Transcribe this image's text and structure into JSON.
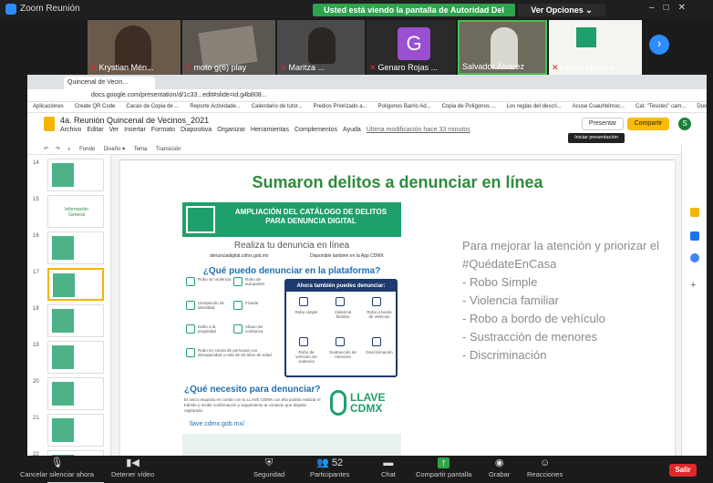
{
  "zoom": {
    "window_title": "Zoom Reunión",
    "share_banner": "Usted está viendo la pantalla de Autoridad Del Centro Histórico",
    "view_options": "Ver Opciones ⌄",
    "participants": [
      {
        "name": "Krystian Mén..."
      },
      {
        "name": "moto g(6) play"
      },
      {
        "name": "Maritza ..."
      },
      {
        "name": "Genaro Rojas ...",
        "initial": "G"
      },
      {
        "name": "Salvador Álvarez"
      },
      {
        "name": "Leticia Herrera"
      }
    ],
    "controls": {
      "audio": "Cancelar silenciar ahora",
      "video": "Detener vídeo",
      "security": "Seguridad",
      "participants": "Participantes",
      "participants_count": "52",
      "chat": "Chat",
      "share": "Compartir pantalla",
      "record": "Grabar",
      "reactions": "Reacciones",
      "leave": "Salir"
    }
  },
  "browser": {
    "tab_title": "Quincenal de Vecin...",
    "url": "docs.google.com/presentation/d/1c33...edit#slide=id.g4b808...",
    "bookmarks": [
      "Aplicaciones",
      "Create QR Code",
      "Cacao de Copia de ...",
      "Reporte Actividade...",
      "Calendario de tutor...",
      "Predios Priorizado a...",
      "Polígonos Barrio Ad...",
      "Copia de Polígonos ...",
      "Los reglas del descri...",
      "Acuse Cuauhtémoc...",
      "Cat. \"Tesoles\" cam...",
      "Duo familias de apa..."
    ]
  },
  "slides_app": {
    "doc_title": "4a. Reunión Quincenal de Vecinos_2021",
    "menus": [
      "Archivo",
      "Editar",
      "Ver",
      "Insertar",
      "Formato",
      "Diapositiva",
      "Organizar",
      "Herramientas",
      "Complementos",
      "Ayuda",
      "Última modificación hace 33 minutos"
    ],
    "present_label": "Presentar",
    "share_label": "Compartir",
    "tooltip": "Iniciar presentación (Ctrl+F5)",
    "user_initial": "S",
    "toolbar": [
      "Fondo",
      "Diseño ▾",
      "Tema",
      "Transición"
    ],
    "thumb_numbers": [
      "14",
      "15",
      "16",
      "17",
      "18",
      "19",
      "20",
      "21",
      "22"
    ],
    "thumb_15_text": "Información General",
    "selected_slide": "17"
  },
  "slide": {
    "title": "Sumaron delitos a denunciar en línea",
    "bullets": [
      "Para mejorar la atención y priorizar el #QuédateEnCasa",
      "- Robo Simple",
      "- Violencia familiar",
      "- Robo a bordo de vehículo",
      "- Sustracción de menores",
      "- Discriminación"
    ],
    "poster": {
      "header": "AMPLIACIÓN DEL CATÁLOGO DE DELITOS PARA DENUNCIA DIGITAL",
      "subtitle": "Realiza tu denuncia en línea",
      "site": "denunciadigital.cdmx.gob.mx",
      "app": "Disponible también en la App CDMX",
      "question1": "¿Qué puedo denunciar en la plataforma?",
      "left_items": [
        "Robo sin violencia",
        "Robo de autopartes",
        "Usurpación de identidad",
        "Fraude",
        "Daño a la propiedad",
        "Abuso de confianza",
        "Robo en contra de personas con discapacidad o más de 60 años de edad"
      ],
      "box_title": "Ahora también puedes denunciar:",
      "box_items": [
        "Robo simple",
        "Violencia familiar",
        "Robo a bordo de vehículo",
        "Robo de vehículo sin violencia",
        "Sustracción de menores",
        "Discriminación"
      ],
      "question2": "¿Qué necesito para denunciar?",
      "text": "El único requisito es contar con tu LLAVE CDMX con ella podrás realizar el trámite y recibir confirmación y seguimiento al contacto que dejaste registrado.",
      "link": "llave.cdmx.gob.mx/",
      "llave": "LLAVE CDMX"
    }
  }
}
